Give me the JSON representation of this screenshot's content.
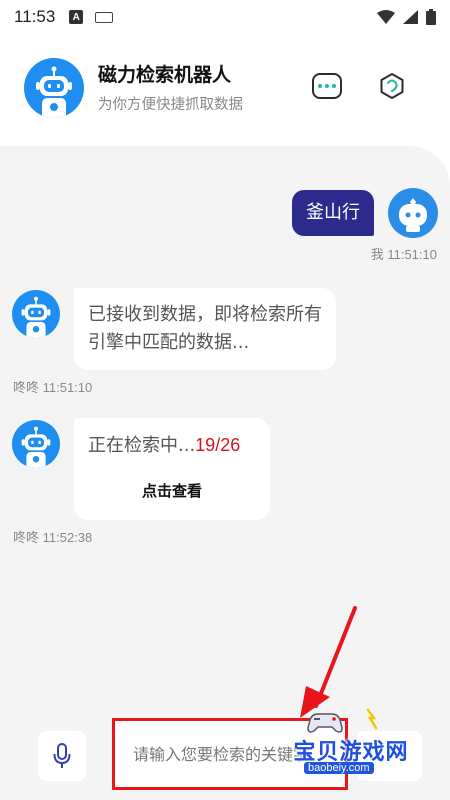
{
  "status_bar": {
    "time": "11:53",
    "a_icon": "A"
  },
  "header": {
    "title": "磁力检索机器人",
    "subtitle": "为你方便快捷抓取数据"
  },
  "messages": [
    {
      "sender": "user",
      "text": "釜山行",
      "meta": "我 11:51:10"
    },
    {
      "sender": "bot",
      "text": "已接收到数据，即将检索所有引擎中匹配的数据...",
      "meta": "咚咚 11:51:10"
    },
    {
      "sender": "bot",
      "text": "正在检索中...",
      "progress": "19/26",
      "action_label": "点击查看",
      "meta": "咚咚 11:52:38"
    }
  ],
  "input": {
    "placeholder": "请输入您要检索的关键字"
  },
  "watermark": {
    "title": "宝贝游戏网",
    "url": "baobeiy.com"
  },
  "colors": {
    "accent": "#2d2a8e",
    "avatar_blue": "#1e8ff0",
    "highlight_red": "#e8161c",
    "dots_teal": "#22b8a0"
  },
  "icons": [
    "robot-icon",
    "more-dots-icon",
    "hexagon-icon",
    "mic-icon",
    "wifi-icon",
    "signal-icon",
    "battery-icon"
  ]
}
